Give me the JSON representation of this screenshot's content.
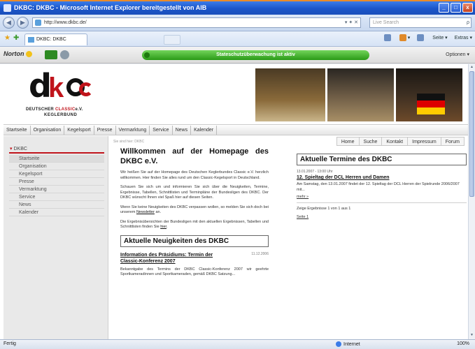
{
  "window": {
    "title": "DKBC: DKBC - Microsoft Internet Explorer bereitgestellt von AIB",
    "minimize": "_",
    "maximize": "□",
    "close": "x"
  },
  "browser": {
    "back": "◀",
    "forward": "▶",
    "address": "http://www.dkbc.de/",
    "address_controls": "▾ ✦ ✕",
    "search_placeholder": "Live Search",
    "search_button": "ρ",
    "tab_label": "DKBC: DKBC",
    "command_bar": [
      "▾",
      "Seite ▾",
      "Extras ▾"
    ]
  },
  "norton": {
    "brand": "Norton",
    "bar": "Stateschutzüberwachung ist aktiv",
    "options": "Optionen ▾"
  },
  "site": {
    "logo": {
      "tagline_black": "DEUTSCHER",
      "tagline_red": "CLASSIC",
      "tagline_suffix": "e.V.",
      "tagline2": "KEGLERBUND"
    },
    "main_nav": [
      "Startseite",
      "Organisation",
      "Kegelsport",
      "Presse",
      "Vermarktung",
      "Service",
      "News",
      "Kalender"
    ],
    "breadcrumb": "Sie sind hier: DKBC",
    "sub_nav": [
      "Home",
      "Suche",
      "Kontakt",
      "Impressum",
      "Forum"
    ],
    "sidebar": {
      "section": "DKBC",
      "items": [
        "Startseite",
        "Organisation",
        "Kegelsport",
        "Presse",
        "Vermarktung",
        "Service",
        "News",
        "Kalender"
      ]
    },
    "welcome": {
      "title": "Willkommen auf der Homepage des DKBC e.V.",
      "p1": "Wir heißen Sie auf der Homepage des Deutschen Keglerbundes Classic e.V. herzlich willkommen. Hier finden Sie alles rund um den Classic-Kegelsport in Deutschland.",
      "p2": "Schauen Sie sich um und informieren Sie sich über die Neuigkeiten, Termine, Ergebnisse, Tabellen, Schnittlisten und Terminpläne der Bundesligen des DKBC. Der DKBC wünscht Ihnen viel Spaß hier auf diesen Seiten.",
      "p3_pre": "Wenn Sie keine Neuigkeiten des DKBC verpassen wollen, so melden Sie sich doch bei unserem",
      "p3_link": "Newsletter",
      "p3_post": "an.",
      "p4_pre": "Die Ergebnisübersichten der Bundesligen mit den aktuellen Ergebnissen, Tabellen und Schnittlisten finden Sie",
      "p4_link": "hier",
      "p4_post": "."
    },
    "news": {
      "box_title": "Aktuelle Neuigkeiten des DKBC",
      "item_title": "Information des Präsidiums: Termin der Classic-Konferenz 2007",
      "item_date": "11.12.2006",
      "item_body": "Bekanntgabe des Termins der DKBC Classic-Konferenz 2007 wir geehrte Sportkameradinnen und Sportkameraden, gemäß DKBC Satzung..."
    },
    "events": {
      "box_title": "Aktuelle Termine des DKBC",
      "date": "13.01.2007 - 13:00 Uhr",
      "title": "12. Spieltag der DCL Herren und Damen",
      "body": "Am Samstag, den 13.01.2007 findet der 12. Spieltag der DCL Herren der Spielrunde 2006/2007 mit...",
      "more": "mehr »",
      "results": "Zeige Ergebnisse 1 von 1 aus 1",
      "page": "Seite 1"
    }
  },
  "statusbar": {
    "status": "Fertig",
    "zone": "Internet",
    "zoom": "100%"
  },
  "colors": {
    "accent_red": "#c0141b",
    "xp_blue": "#1b55c9",
    "norton_green": "#2a9a17"
  }
}
